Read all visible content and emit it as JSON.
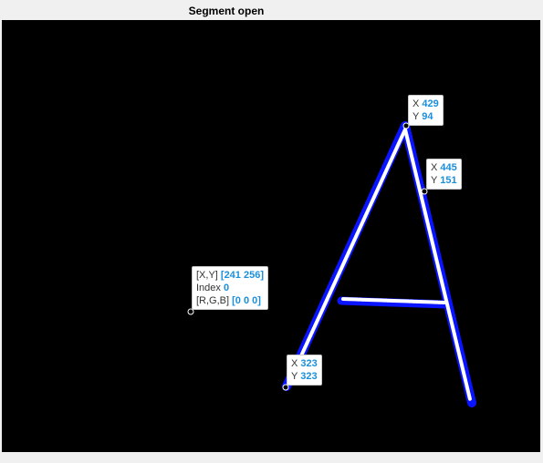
{
  "window": {
    "title": "Segment open"
  },
  "colors": {
    "background": "#000000",
    "segment_outline": "#0a14ff",
    "segment_fill": "#ffffff",
    "tip_value": "#1a8fdc"
  },
  "datatips": [
    {
      "id": "tip-429-94",
      "x_label": "X",
      "x": "429",
      "y_label": "Y",
      "y": "94"
    },
    {
      "id": "tip-445-151",
      "x_label": "X",
      "x": "445",
      "y_label": "Y",
      "y": "151"
    },
    {
      "id": "tip-323-323",
      "x_label": "X",
      "x": "323",
      "y_label": "Y",
      "y": "323"
    }
  ],
  "pixel_tip": {
    "xy_label": "[X,Y]",
    "xy": "[241 256]",
    "index_label": "Index",
    "index": "0",
    "rgb_label": "[R,G,B]",
    "rgb": "[0 0 0]"
  }
}
